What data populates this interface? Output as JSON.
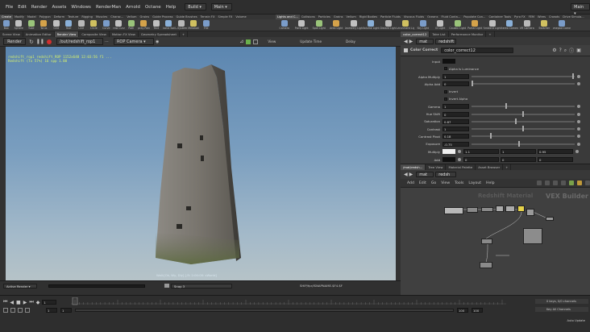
{
  "menu": {
    "items": [
      "File",
      "Edit",
      "Render",
      "Assets",
      "Windows",
      "RenderMan",
      "Arnold",
      "Octane",
      "Help"
    ],
    "desktop": "Build",
    "context": "Main"
  },
  "shelf_left": {
    "tabs": [
      "Create",
      "Modify",
      "Model",
      "Polygon",
      "Deform",
      "Texture",
      "Rigging",
      "Muscles",
      "Charac...",
      "Vellum",
      "Grains",
      "Guide Process",
      "Guide Brushes",
      "Terrain FX",
      "Simple FX",
      "Volume"
    ],
    "tools": [
      "Box",
      "Sphere",
      "Tube",
      "Torus",
      "Grid",
      "Null",
      "Line",
      "Circle",
      "Curve",
      "Draw Curve",
      "Path",
      "Spray Paint",
      "Text",
      "Platonic Solids",
      "L-System",
      "Metaball",
      "File"
    ]
  },
  "shelf_right": {
    "tabs": [
      "Lights and C...",
      "Collisions",
      "Particles",
      "Grains",
      "Vellum",
      "Rigid Bodies",
      "Particle Fluids",
      "Viscous Fluids",
      "Oceans",
      "Fluid Conta...",
      "Populate Con...",
      "Container Tools",
      "Pyro FX",
      "FEM",
      "Wires",
      "Crowds",
      "Drive Simula..."
    ],
    "tools": [
      "Camera",
      "Point Light",
      "Spot Light",
      "Area Light",
      "Geometry Light",
      "Volume Light",
      "Distant Light",
      "Environment Light",
      "Sky Light",
      "GI Light",
      "Caustic Light",
      "Portal Light",
      "Ambient Light",
      "Stereo Camera",
      "VR Camera",
      "Switcher",
      "Gamepad Camera"
    ]
  },
  "viewport": {
    "tabs": [
      "Scene View",
      "Animation Editor",
      "Render View",
      "Composite View",
      "Motion FX View",
      "Geometry Spreadsheet"
    ],
    "active_tab": "Render View",
    "render_button": "Render",
    "output_path": "/out/redshift_rop1",
    "camera": "ROP Camera",
    "view_label": "View",
    "update_label": "Update Time",
    "delay_label": "Delay",
    "info_line1": "redshift_rop1 redshift_ROP 1152x648 12:03:56  f1  ...",
    "info_line2": "Redshift (Tx 57%) 16 spp 1.00",
    "bottom_label": "Wall:[Ok, Wy, Dly] [-R: 2:00:00: sWorld]",
    "snap_label": "Snap 3",
    "file_path": "SHIP/fpr/ISNAPNAME.$F4.$F",
    "tower_colors": {
      "light": "#8f8a82",
      "mid": "#6f6b64",
      "dark": "#4a4843",
      "moss": "#5d6b3e"
    }
  },
  "params": {
    "header_tabs": [
      "color_correct12",
      "Take List",
      "Performance Monitor"
    ],
    "path": "mat",
    "path2": "redshift",
    "node_type": "Color Correct",
    "node_name": "color_correct12",
    "input_label": "Input",
    "alpha_luminance": "Alpha Is Luminance",
    "rows": [
      {
        "label": "Alpha Multiply",
        "value": "1",
        "knob": 0.99
      },
      {
        "label": "Alpha Add",
        "value": "0",
        "knob": 0.0
      },
      {
        "label": "Invert",
        "value": "",
        "knob": null
      },
      {
        "label": "Invert Alpha",
        "value": "",
        "knob": null
      },
      {
        "label": "Gamma",
        "value": "1",
        "knob": 0.33
      },
      {
        "label": "Hue Shift",
        "value": "0",
        "knob": 0.5
      },
      {
        "label": "Saturation",
        "value": "0.87",
        "knob": 0.43
      },
      {
        "label": "Contrast",
        "value": "1",
        "knob": 0.5
      },
      {
        "label": "Contrast Pivot",
        "value": "0.18",
        "knob": 0.18
      },
      {
        "label": "Exposure",
        "value": "-0.75",
        "knob": 0.46
      }
    ],
    "multiply_label": "Multiply",
    "multiply_values": [
      "1.1",
      "1",
      "0.95"
    ],
    "add_label": "Add",
    "add_values": [
      "0",
      "0",
      "0"
    ]
  },
  "network": {
    "tabs": [
      "/mat/redsh...",
      "Tree View",
      "Material Palette",
      "Asset Browser"
    ],
    "path": "mat",
    "path2": "redsh",
    "menu": [
      "Add",
      "Edit",
      "Go",
      "View",
      "Tools",
      "Layout",
      "Help"
    ],
    "title_left": "Redshift Material",
    "title_right": "VEX Builder"
  },
  "timeline": {
    "frame": "1",
    "start": "1",
    "end": "100",
    "end2": "100",
    "tick_labels": [
      "1",
      "10",
      "20",
      "30",
      "40",
      "50",
      "60",
      "70",
      "80",
      "90",
      "100"
    ],
    "keys_label": "0 keys, 0/0 channels",
    "key_all": "Key All Channels",
    "auto_update": "Auto Update",
    "active_render": "Active Render"
  }
}
